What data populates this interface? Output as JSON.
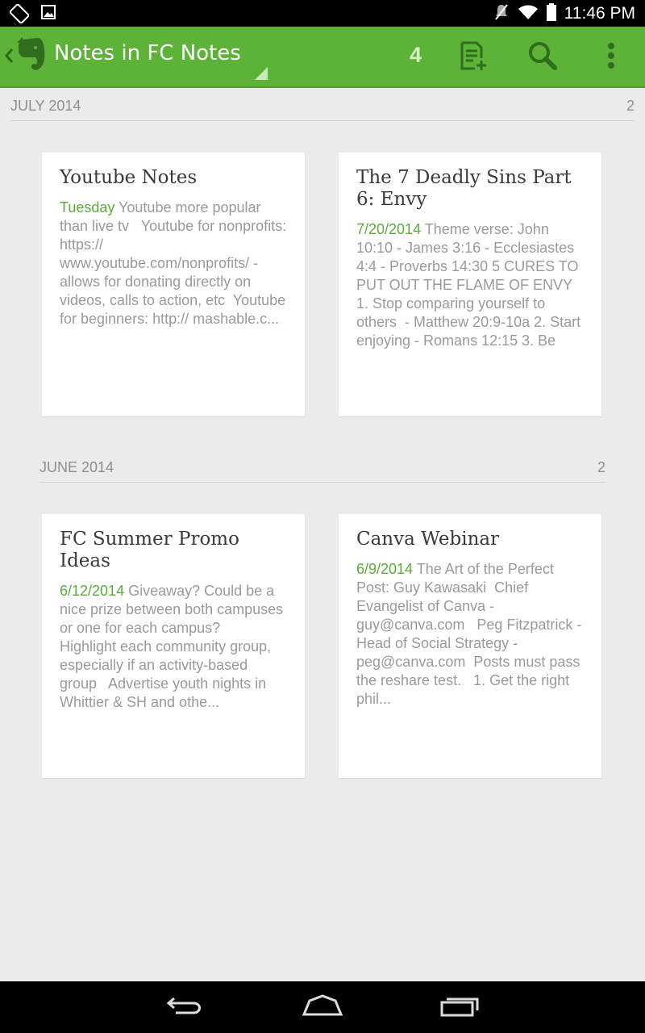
{
  "status_bar": {
    "time": "11:46 PM",
    "icons": [
      "screen-rotate-icon",
      "image-icon",
      "mute-icon",
      "wifi-icon",
      "battery-icon"
    ]
  },
  "app_bar": {
    "title": "Notes in FC Notes",
    "note_count": "4",
    "icons": [
      "back-chevron-icon",
      "evernote-elephant-icon",
      "new-note-icon",
      "search-icon",
      "overflow-menu-icon"
    ],
    "accent_color": "#5cb338"
  },
  "sections": [
    {
      "label": "JULY 2014",
      "count": "2",
      "notes": [
        {
          "title": "Youtube Notes",
          "date": "Tuesday",
          "snippet": " Youtube more popular than live tv   Youtube for nonprofits: https:// www.youtube.com/nonprofits/ - allows for donating directly on videos, calls to action, etc  Youtube for beginners: http:// mashable.c..."
        },
        {
          "title": "The 7 Deadly Sins Part 6: Envy",
          "date": "7/20/2014",
          "snippet": " Theme verse: John 10:10 - James 3:16 - Ecclesiastes 4:4 - Proverbs 14:30 5 CURES TO PUT OUT THE FLAME OF ENVY 1. Stop comparing yourself to others  - Matthew 20:9-10a 2. Start enjoying - Romans 12:15 3. Be"
        }
      ]
    },
    {
      "label": "JUNE 2014",
      "count": "2",
      "notes": [
        {
          "title": "FC Summer Promo Ideas",
          "date": "6/12/2014",
          "snippet": " Giveaway? Could be a nice prize between both campuses or one for each campus?    Highlight each community group, especially if an activity-based group   Advertise youth nights in Whittier & SH and othe..."
        },
        {
          "title": "Canva Webinar",
          "date": "6/9/2014",
          "snippet": " The Art of the Perfect Post: Guy Kawasaki  Chief Evangelist of Canva - guy@canva.com   Peg Fitzpatrick - Head of Social Strategy - peg@canva.com  Posts must pass the reshare test.   1. Get the right phil..."
        }
      ]
    }
  ],
  "nav_bar": {
    "icons": [
      "back-icon",
      "home-icon",
      "recent-apps-icon"
    ]
  }
}
